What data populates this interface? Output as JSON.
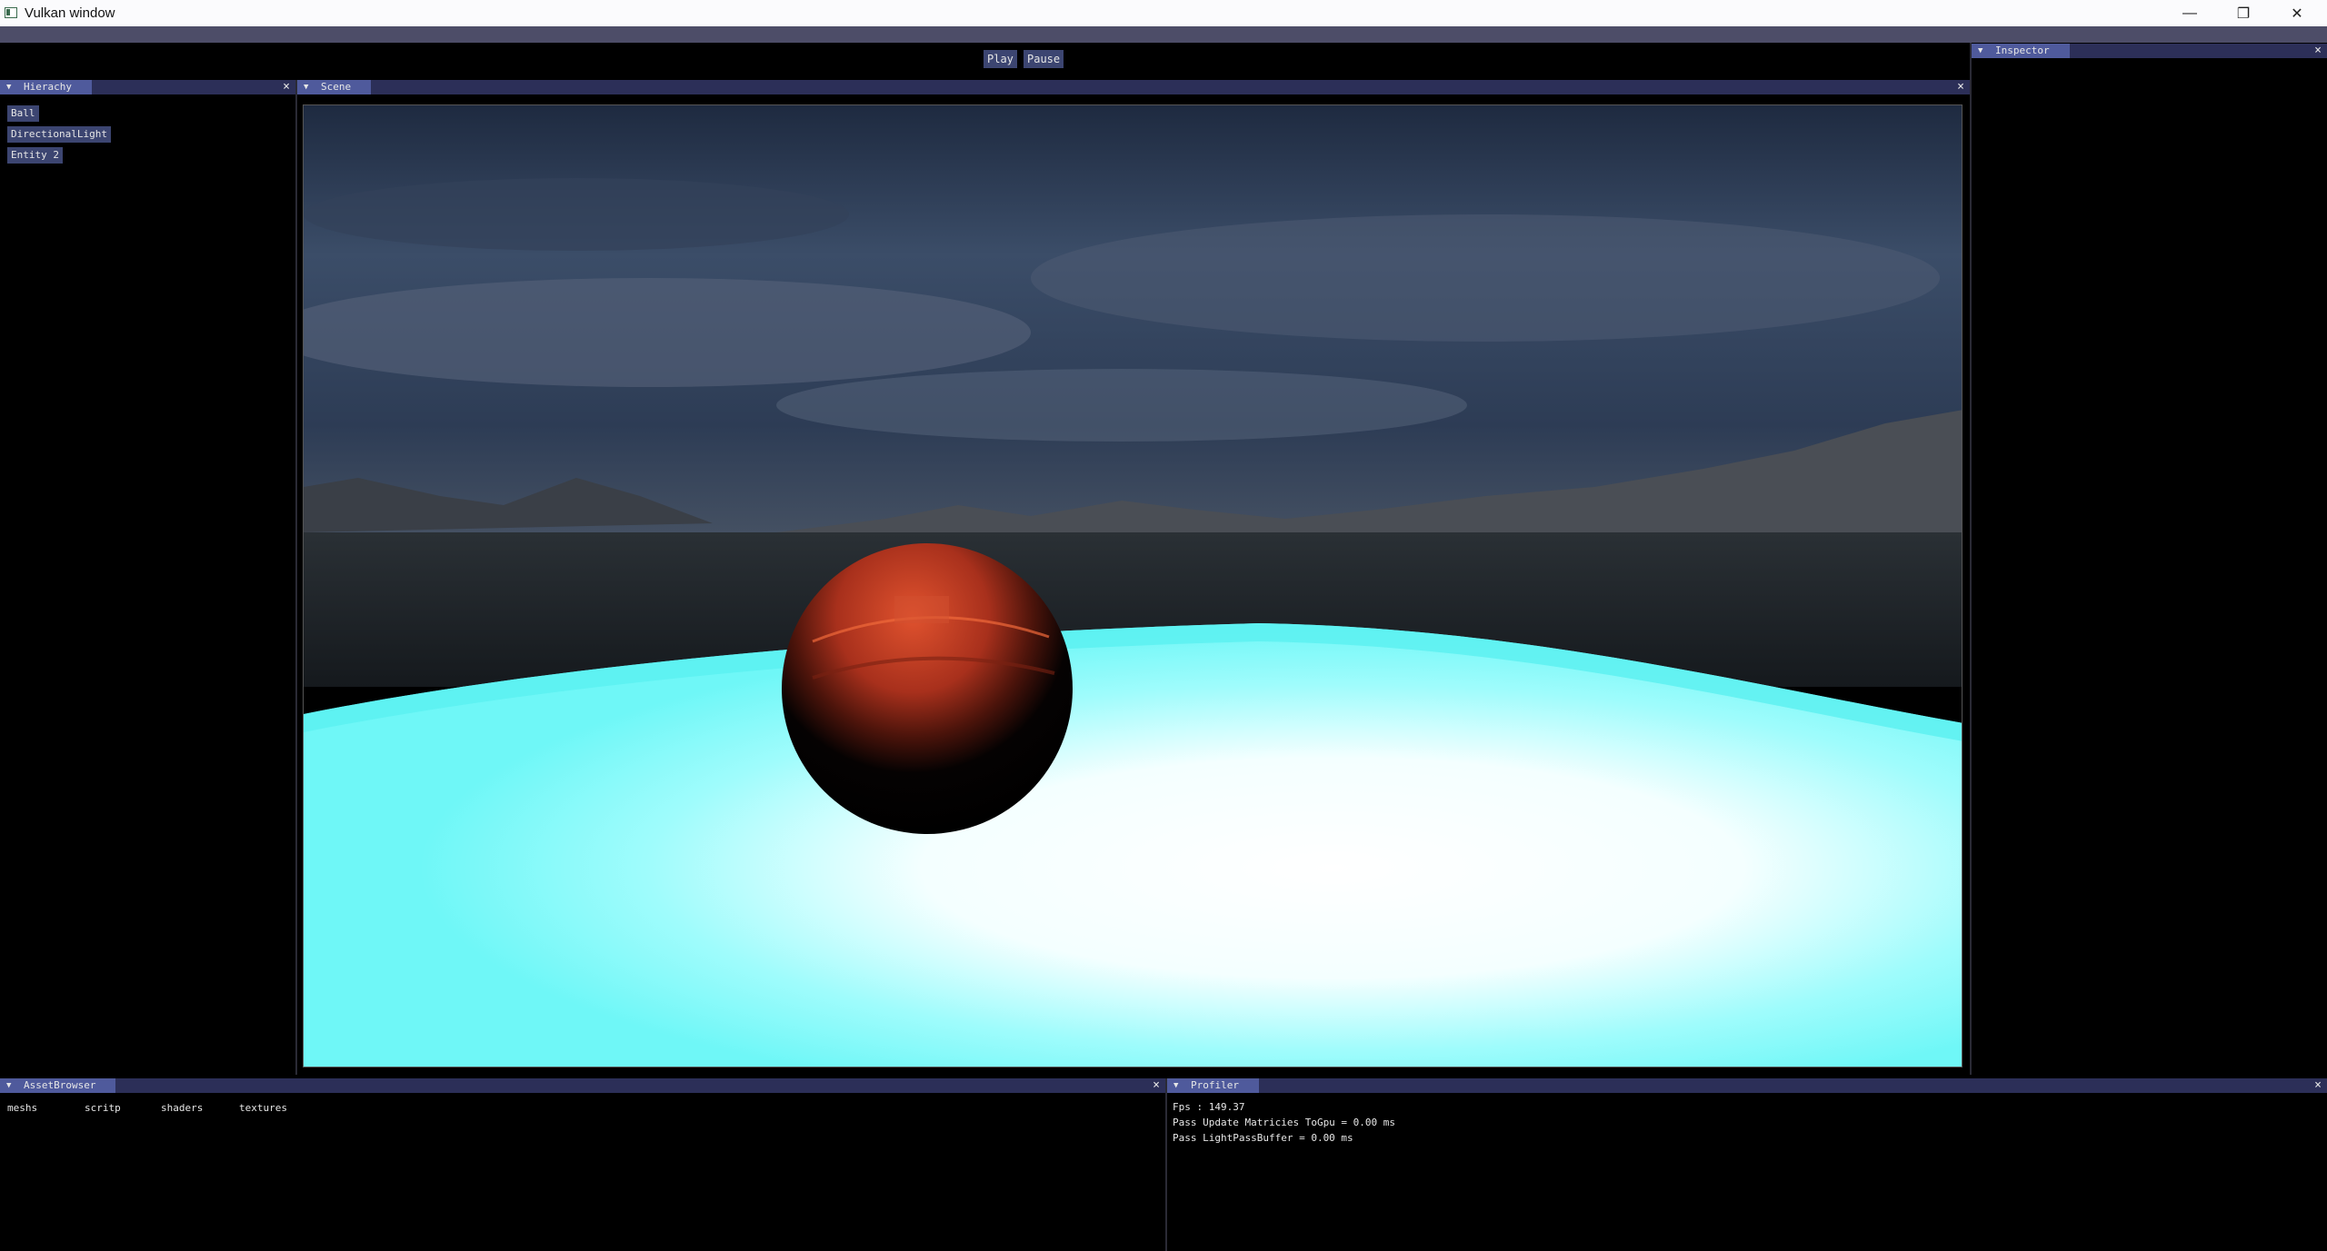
{
  "window": {
    "title": "Vulkan window",
    "minimize": "—",
    "maximize": "❐",
    "close": "✕"
  },
  "toolbar": {
    "play_label": "Play",
    "pause_label": "Pause"
  },
  "hierarchy": {
    "title": "Hierachy",
    "items": [
      {
        "label": "Ball"
      },
      {
        "label": "DirectionalLight"
      },
      {
        "label": "Entity 2"
      }
    ]
  },
  "scene": {
    "title": "Scene"
  },
  "inspector": {
    "title": "Inspector"
  },
  "asset_browser": {
    "title": "AssetBrowser",
    "folders": [
      {
        "label": "meshs"
      },
      {
        "label": "scritp"
      },
      {
        "label": "shaders"
      },
      {
        "label": "textures"
      }
    ]
  },
  "profiler": {
    "title": "Profiler",
    "lines": [
      {
        "text": "Fps : 149.37"
      },
      {
        "text": "Pass Update Matricies ToGpu = 0.00 ms"
      },
      {
        "text": "Pass LightPassBuffer = 0.00 ms"
      }
    ]
  },
  "icons": {
    "collapse": "▼",
    "panel_close": "×"
  },
  "colors": {
    "tab_active": "#4f5a9c",
    "tab_bar": "#2c2f58",
    "button_bg": "#3c4571",
    "floor_cyan": "#6ff7f7",
    "ball_red": "#b8341c"
  }
}
